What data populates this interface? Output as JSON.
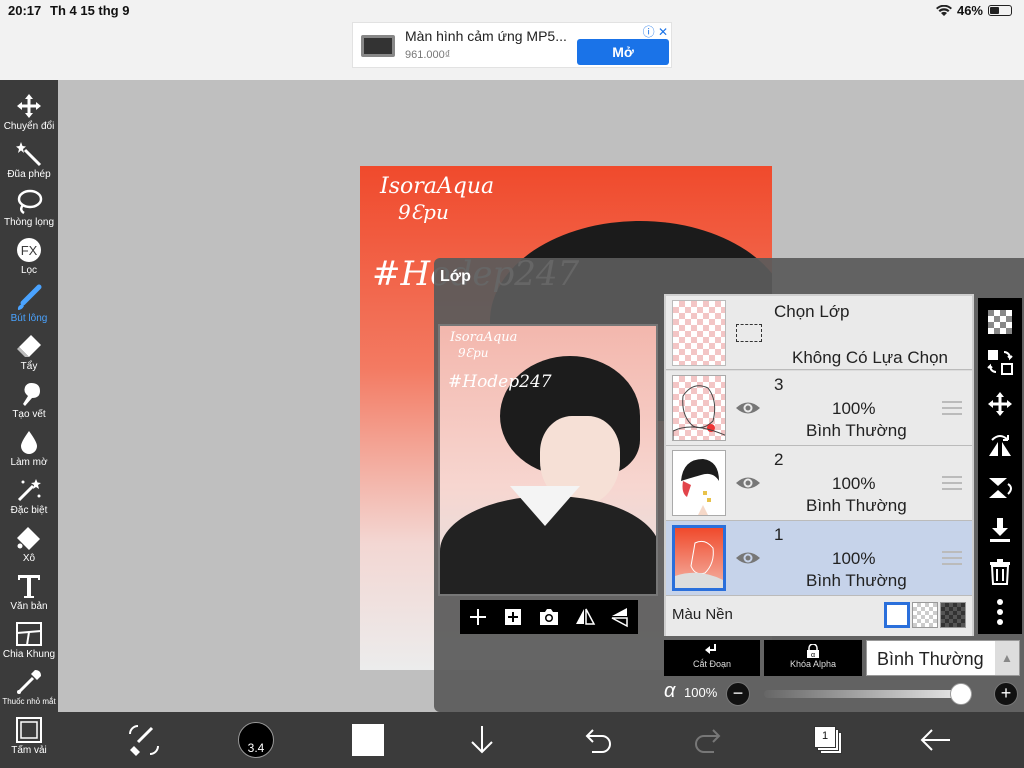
{
  "status": {
    "time": "20:17",
    "date": "Th 4 15 thg 9",
    "battery": "46%",
    "battery_level": 0.46
  },
  "ad": {
    "title": "Màn hình cảm ứng MP5...",
    "price": "961.000₫",
    "button": "Mở"
  },
  "tools": [
    {
      "label": "Chuyển đổi",
      "icon": "move-icon"
    },
    {
      "label": "Đũa phép",
      "icon": "magic-wand-icon"
    },
    {
      "label": "Thòng lọng",
      "icon": "lasso-icon"
    },
    {
      "label": "Lọc",
      "icon": "fx-icon"
    },
    {
      "label": "Bút lông",
      "icon": "brush-icon",
      "active": true
    },
    {
      "label": "Tẩy",
      "icon": "eraser-icon"
    },
    {
      "label": "Tạo vết",
      "icon": "smudge-icon"
    },
    {
      "label": "Làm mờ",
      "icon": "blur-drop-icon"
    },
    {
      "label": "Đặc biệt",
      "icon": "special-brush-icon"
    },
    {
      "label": "Xô",
      "icon": "bucket-icon"
    },
    {
      "label": "Văn bản",
      "icon": "text-icon"
    },
    {
      "label": "Chia Khung",
      "icon": "frame-divider-icon"
    },
    {
      "label": "Thuốc nhỏ mắt",
      "icon": "eyedropper-icon"
    },
    {
      "label": "Tấm vải",
      "icon": "canvas-icon"
    }
  ],
  "canvas": {
    "signature": "IsoraAqua",
    "signature2": "9Ɛpu",
    "hashtag": "#Hodep247"
  },
  "layers_panel": {
    "title": "Lớp",
    "selection": {
      "title": "Chọn Lớp",
      "subtitle": "Không Có Lựa Chọn"
    },
    "layers": [
      {
        "number": "3",
        "opacity": "100%",
        "mode": "Bình Thường",
        "selected": false
      },
      {
        "number": "2",
        "opacity": "100%",
        "mode": "Bình Thường",
        "selected": false
      },
      {
        "number": "1",
        "opacity": "100%",
        "mode": "Bình Thường",
        "selected": true
      }
    ],
    "background_label": "Màu Nền",
    "clip_label": "Cắt Đoạn",
    "alpha_lock_label": "Khóa Alpha",
    "blend_mode": "Bình Thường",
    "alpha_value": "100%",
    "alpha_symbol": "α",
    "alpha_fraction": 1.0
  },
  "bottom_toolbar": {
    "brush_size": "3.4",
    "layer_count": "1"
  },
  "colors": {
    "accent": "#4aa3ff",
    "selected_row": "#c6d3ea",
    "toolbar": "#3b3b3b"
  }
}
